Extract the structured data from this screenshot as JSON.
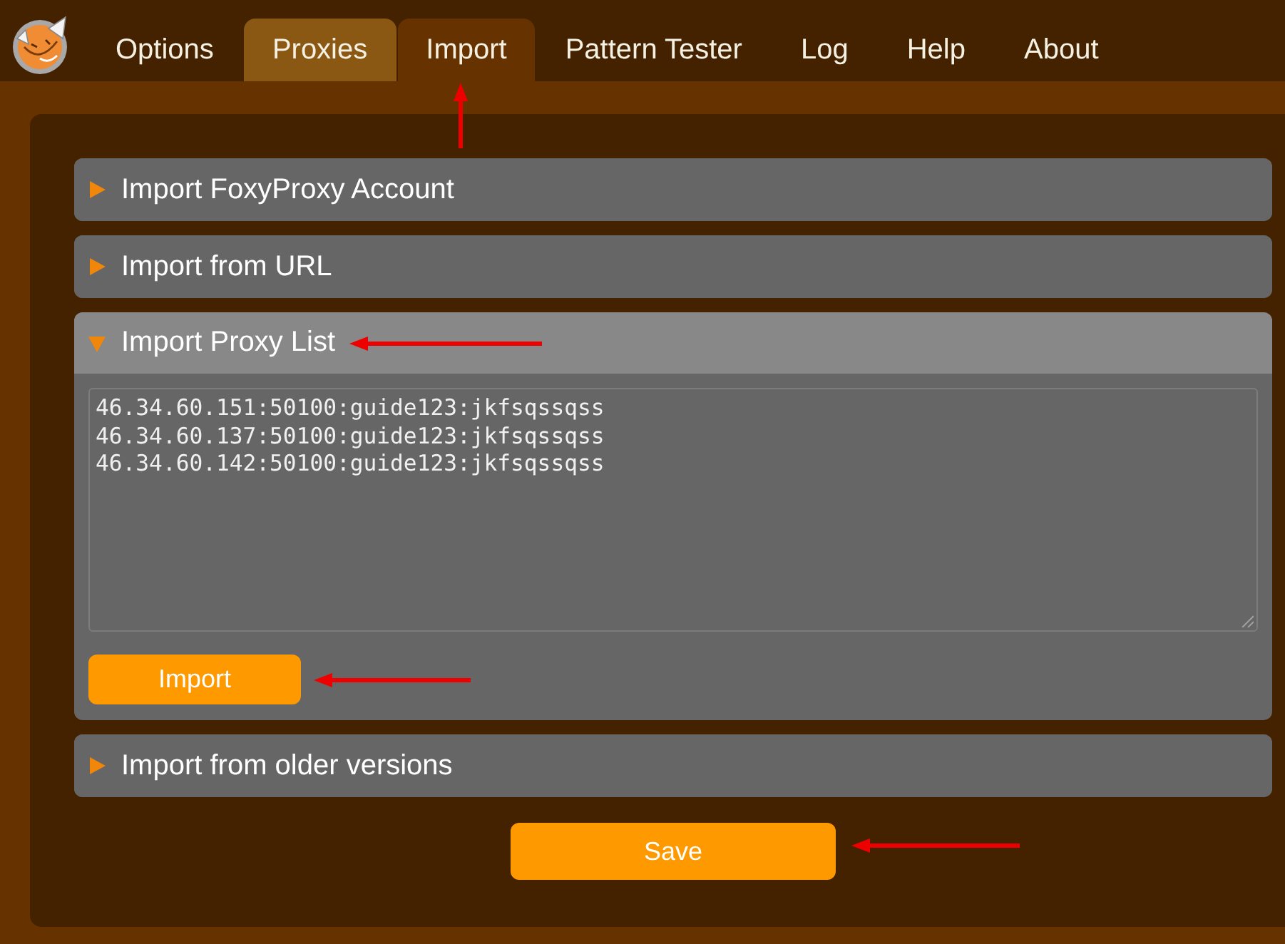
{
  "tabs": [
    {
      "label": "Options",
      "selected": false,
      "hovered": false,
      "annotated": false
    },
    {
      "label": "Proxies",
      "selected": false,
      "hovered": true,
      "annotated": false
    },
    {
      "label": "Import",
      "selected": true,
      "hovered": false,
      "annotated": true
    },
    {
      "label": "Pattern Tester",
      "selected": false,
      "hovered": false,
      "annotated": false
    },
    {
      "label": "Log",
      "selected": false,
      "hovered": false,
      "annotated": false
    },
    {
      "label": "Help",
      "selected": false,
      "hovered": false,
      "annotated": false
    },
    {
      "label": "About",
      "selected": false,
      "hovered": false,
      "annotated": false
    }
  ],
  "sections": [
    {
      "title": "Import FoxyProxy Account",
      "expanded": false,
      "annotated": false
    },
    {
      "title": "Import from URL",
      "expanded": false,
      "annotated": false
    },
    {
      "title": "Import Proxy List",
      "expanded": true,
      "annotated": true,
      "proxy_list": {
        "value": "46.34.60.151:50100:guide123:jkfsqssqss\n46.34.60.137:50100:guide123:jkfsqssqss\n46.34.60.142:50100:guide123:jkfsqssqss"
      },
      "button": {
        "label": "Import",
        "annotated": true
      }
    },
    {
      "title": "Import from older versions",
      "expanded": false,
      "annotated": false
    }
  ],
  "save_button": {
    "label": "Save",
    "annotated": true
  }
}
